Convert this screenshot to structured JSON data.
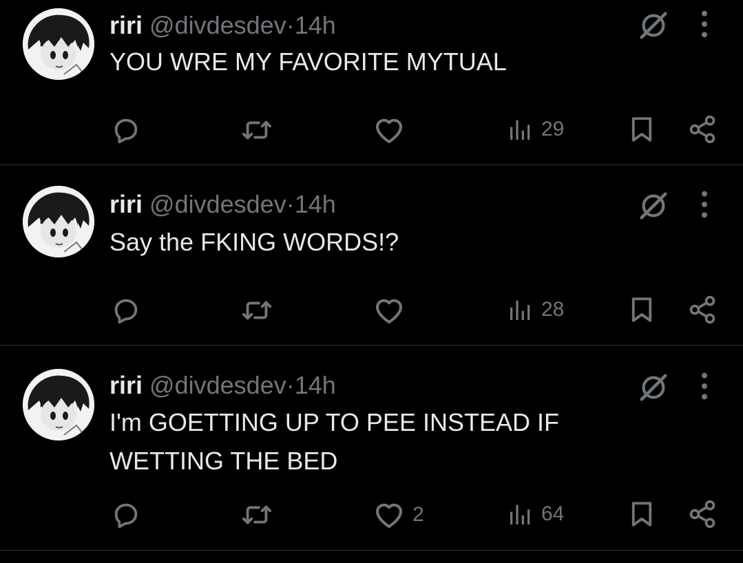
{
  "tweets": [
    {
      "name": "riri",
      "handle": "@divdesdev",
      "dot": "·",
      "time": "14h",
      "text": "YOU WRE MY FAVORITE MYTUAL",
      "likes": "",
      "views": "29"
    },
    {
      "name": "riri",
      "handle": "@divdesdev",
      "dot": "·",
      "time": "14h",
      "text": "Say the FKING WORDS!?",
      "likes": "",
      "views": "28"
    },
    {
      "name": "riri",
      "handle": "@divdesdev",
      "dot": "·",
      "time": "14h",
      "text": "I'm GOETTING UP TO PEE INSTEAD IF WETTING THE BED",
      "likes": "2",
      "views": "64"
    }
  ],
  "icons": {
    "reply": "reply-icon",
    "retweet": "retweet-icon",
    "like": "heart-icon",
    "views": "views-bar-chart-icon",
    "bookmark": "bookmark-icon",
    "share": "share-icon",
    "grok": "grok-icon",
    "more": "more-vertical-icon"
  },
  "colors": {
    "background": "#000000",
    "text": "#e7e9ea",
    "muted": "#71767b",
    "divider": "#2f3336"
  }
}
